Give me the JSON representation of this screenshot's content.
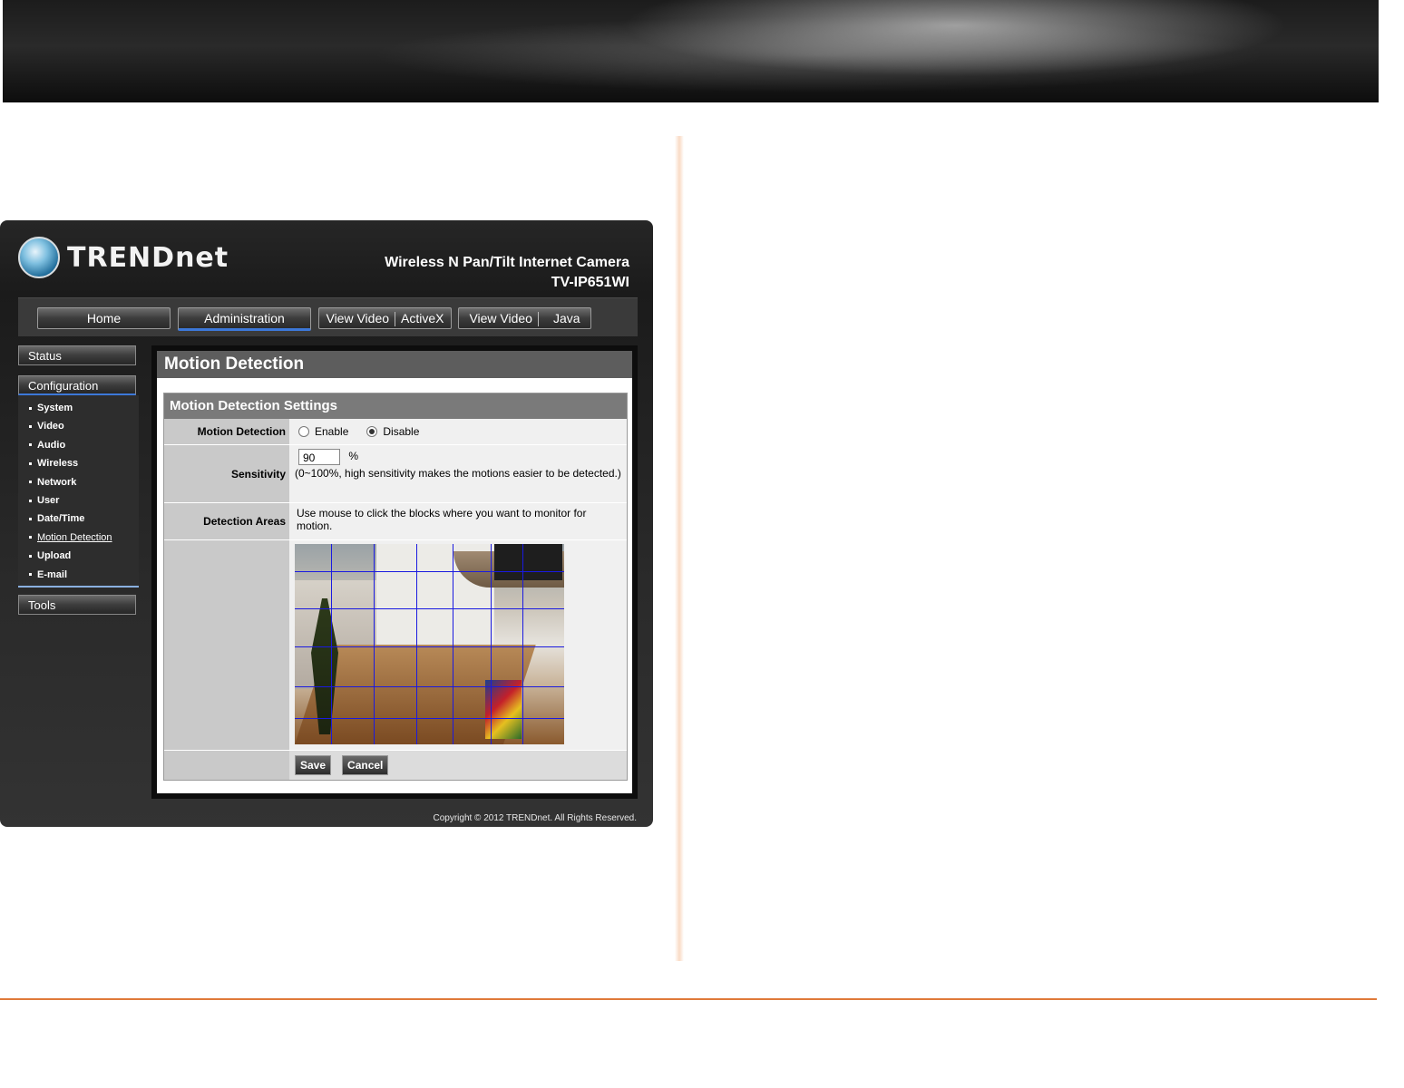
{
  "brand": {
    "logo_text": "TRENDnet",
    "product_line1": "Wireless N Pan/Tilt Internet Camera",
    "product_line2": "TV-IP651WI"
  },
  "nav": {
    "home": "Home",
    "administration": "Administration",
    "view_video_activex_a": "View Video",
    "view_video_activex_b": "ActiveX",
    "view_video_java_a": "View Video",
    "view_video_java_b": "Java"
  },
  "sidebar": {
    "status": "Status",
    "configuration": "Configuration",
    "items": [
      "System",
      "Video",
      "Audio",
      "Wireless",
      "Network",
      "User",
      "Date/Time",
      "Motion Detection",
      "Upload",
      "E-mail"
    ],
    "tools": "Tools"
  },
  "main": {
    "title": "Motion Detection",
    "section_title": "Motion Detection Settings",
    "motion_label": "Motion Detection",
    "enable": "Enable",
    "disable": "Disable",
    "sensitivity_label": "Sensitivity",
    "sensitivity_value": "90",
    "sensitivity_unit": "%",
    "sensitivity_hint": "(0~100%, high sensitivity makes the motions easier to be detected.)",
    "areas_label": "Detection Areas",
    "areas_hint": "Use mouse to click the blocks where you want to monitor for motion.",
    "save": "Save",
    "cancel": "Cancel"
  },
  "footer": {
    "copyright": "Copyright © 2012 TRENDnet.  All Rights Reserved."
  },
  "colors": {
    "accent": "#3c78d8",
    "grid": "#1a1ae0",
    "page_rule": "#e07a3a"
  }
}
